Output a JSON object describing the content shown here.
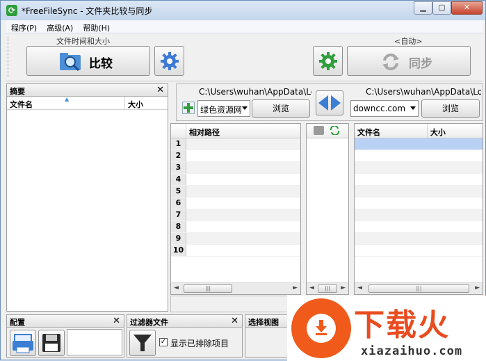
{
  "window": {
    "title": "*FreeFileSync - 文件夹比较与同步",
    "app_icon": "sync-arrows-icon",
    "buttons": [
      "minimize",
      "maximize",
      "close"
    ]
  },
  "menu": {
    "items": [
      "程序(P)",
      "高级(A)",
      "帮助(H)"
    ]
  },
  "toolbar": {
    "compare_caption": "文件时间和大小",
    "compare_label": "比较",
    "sync_caption": "<自动>",
    "sync_label": "同步"
  },
  "summary": {
    "title": "摘要",
    "col_filename": "文件名",
    "col_size": "大小"
  },
  "folders": {
    "left_path": "C:\\Users\\wuhan\\AppData\\Lo",
    "right_path": "C:\\Users\\wuhan\\AppData\\Lo",
    "left_combo": "绿色资源网",
    "right_combo": "downcc.com",
    "browse_left": "浏览",
    "browse_right": "浏览"
  },
  "grid_left": {
    "header": "相对路径",
    "rows": [
      "1",
      "2",
      "3",
      "4",
      "5",
      "6",
      "7",
      "8",
      "9",
      "10"
    ]
  },
  "grid_right": {
    "col_filename": "文件名",
    "col_size": "大小"
  },
  "bottom": {
    "config_title": "配置",
    "filter_title": "过滤器文件",
    "show_excluded": "显示已排除项目",
    "view_title": "选择视图"
  },
  "watermark": {
    "title": "下载火",
    "subtitle": "xiazaihuo.com"
  },
  "colors": {
    "accent": "#3b7fd4",
    "gear_green": "#2f9e3c",
    "watermark": "#e84c1f"
  }
}
